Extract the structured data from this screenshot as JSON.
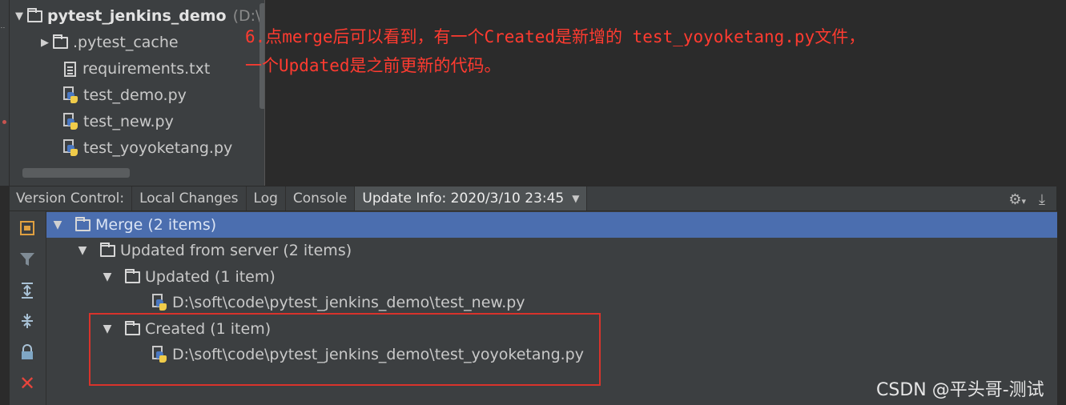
{
  "project": {
    "root_name": "pytest_jenkins_demo",
    "root_path_hint": "(D:\\",
    "items": [
      {
        "label": ".pytest_cache",
        "kind": "folder"
      },
      {
        "label": "requirements.txt",
        "kind": "text-file"
      },
      {
        "label": "test_demo.py",
        "kind": "python-file"
      },
      {
        "label": "test_new.py",
        "kind": "python-file"
      },
      {
        "label": "test_yoyoketang.py",
        "kind": "python-file"
      }
    ]
  },
  "annotation": {
    "line1": "6.点merge后可以看到，有一个Created是新增的 test_yoyoketang.py文件，",
    "line2": "一个Updated是之前更新的代码。"
  },
  "tabs": {
    "label": "Version Control:",
    "items": [
      "Local Changes",
      "Log",
      "Console",
      "Update Info: 2020/3/10 23:45"
    ],
    "active_index": 3
  },
  "side_tools": [
    "group-icon",
    "filter-icon",
    "expand-all-icon",
    "collapse-all-icon",
    "lock-icon",
    "close-icon"
  ],
  "merge_tree": {
    "root": "Merge (2 items)",
    "group": "Updated from server (2 items)",
    "updated": "Updated (1 item)",
    "updated_file": "D:\\soft\\code\\pytest_jenkins_demo\\test_new.py",
    "created": "Created (1 item)",
    "created_file": "D:\\soft\\code\\pytest_jenkins_demo\\test_yoyoketang.py"
  },
  "watermark": "CSDN @平头哥-测试",
  "colors": {
    "selection": "#4b6eaf",
    "annotation": "#ff3b30",
    "highlight_box": "#d9332b",
    "python_blue": "#4a78c2",
    "python_yellow": "#f0cc4a"
  }
}
